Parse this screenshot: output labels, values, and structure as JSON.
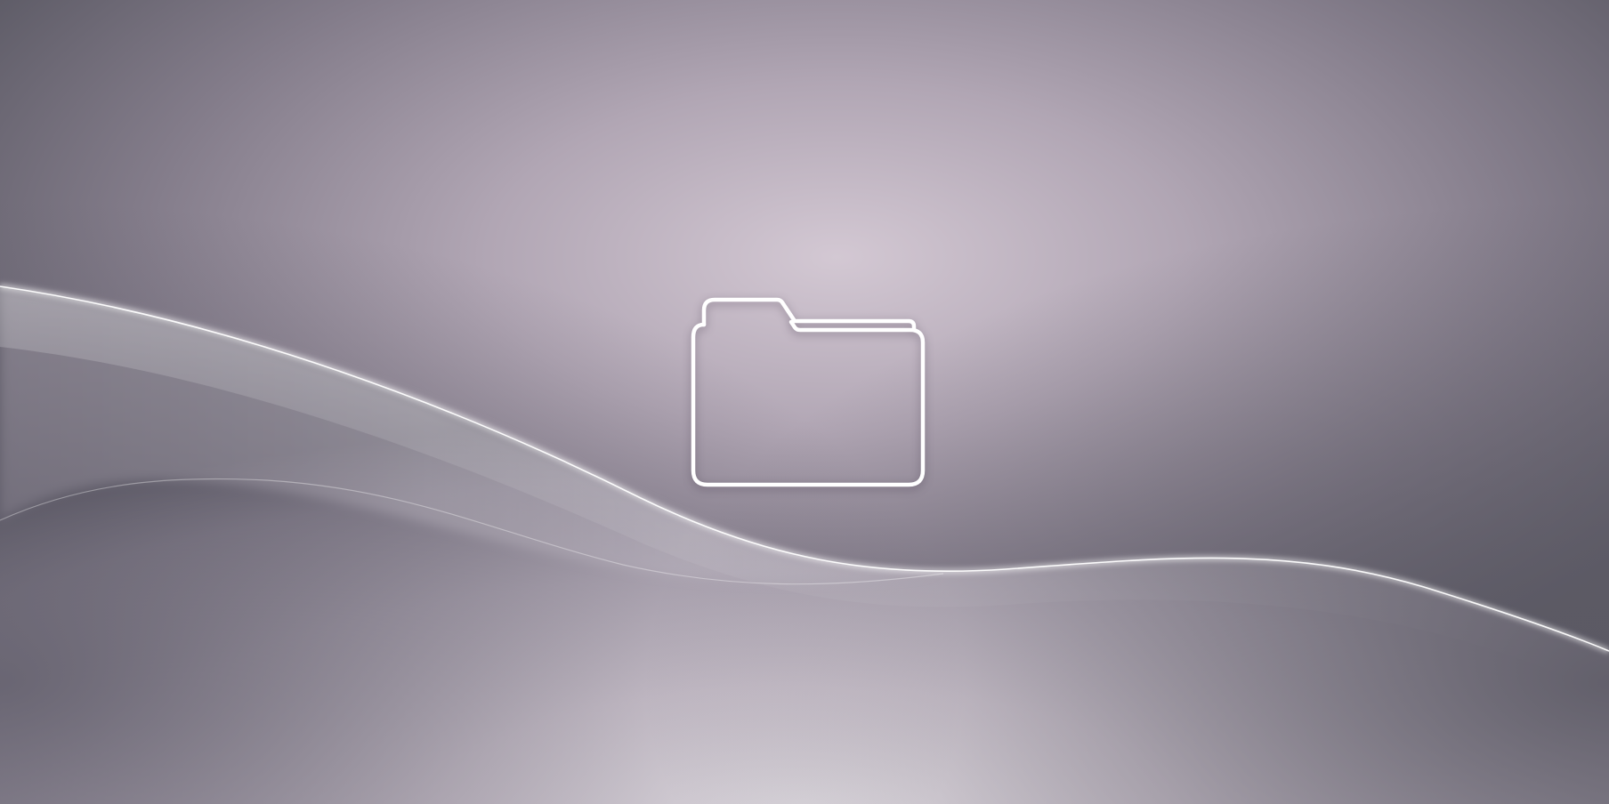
{
  "background": {
    "description_colors": {
      "dark_corner": "#5c5a66",
      "mid_mauve": "#a59cab",
      "light_center": "#efe9f0",
      "wave_highlight": "#ffffff"
    }
  },
  "folder": {
    "icon": "folder-outline-icon",
    "stroke_color": "#ffffff"
  }
}
